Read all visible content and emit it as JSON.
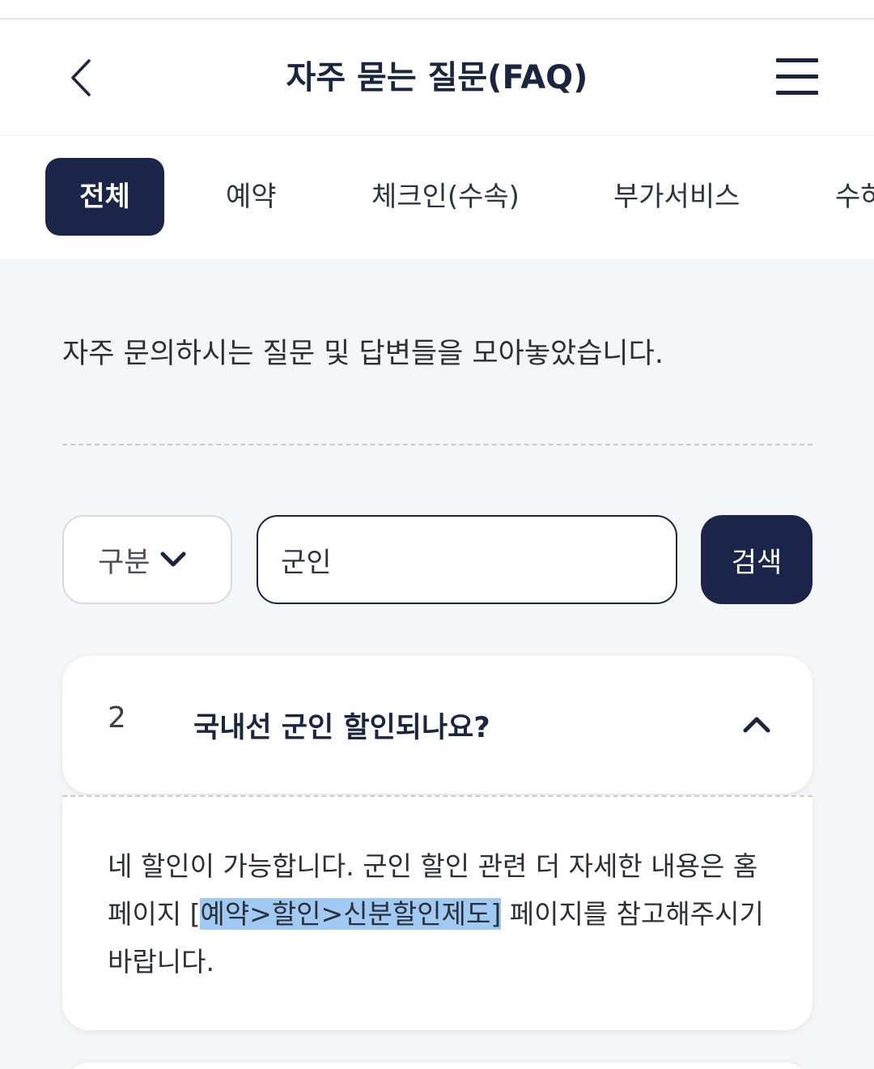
{
  "header": {
    "title": "자주 묻는 질문(FAQ)",
    "back_icon": "chevron-left-icon",
    "menu_icon": "hamburger-menu-icon"
  },
  "tabs": [
    {
      "label": "전체",
      "active": true
    },
    {
      "label": "예약",
      "active": false
    },
    {
      "label": "체크인(수속)",
      "active": false
    },
    {
      "label": "부가서비스",
      "active": false
    },
    {
      "label": "수하",
      "active": false
    }
  ],
  "intro": "자주 문의하시는 질문 및 답변들을 모아놓았습니다.",
  "search": {
    "category_label": "구분",
    "query_value": "군인",
    "button_label": "검색"
  },
  "faq": {
    "number": "2",
    "question": "국내선 군인 할인되나요?",
    "expanded": true,
    "answer_before": "네 할인이 가능합니다. 군인 할인 관련 더 자세한 내용은 홈페이지 ",
    "answer_bracket_open": "[",
    "answer_highlight": "예약>할인>신분할인제도]",
    "answer_after": " 페이지를 참고해주시기 바랍니다."
  },
  "colors": {
    "navy": "#1b2549",
    "background": "#f5f6f7",
    "highlight": "#78b4f0"
  }
}
